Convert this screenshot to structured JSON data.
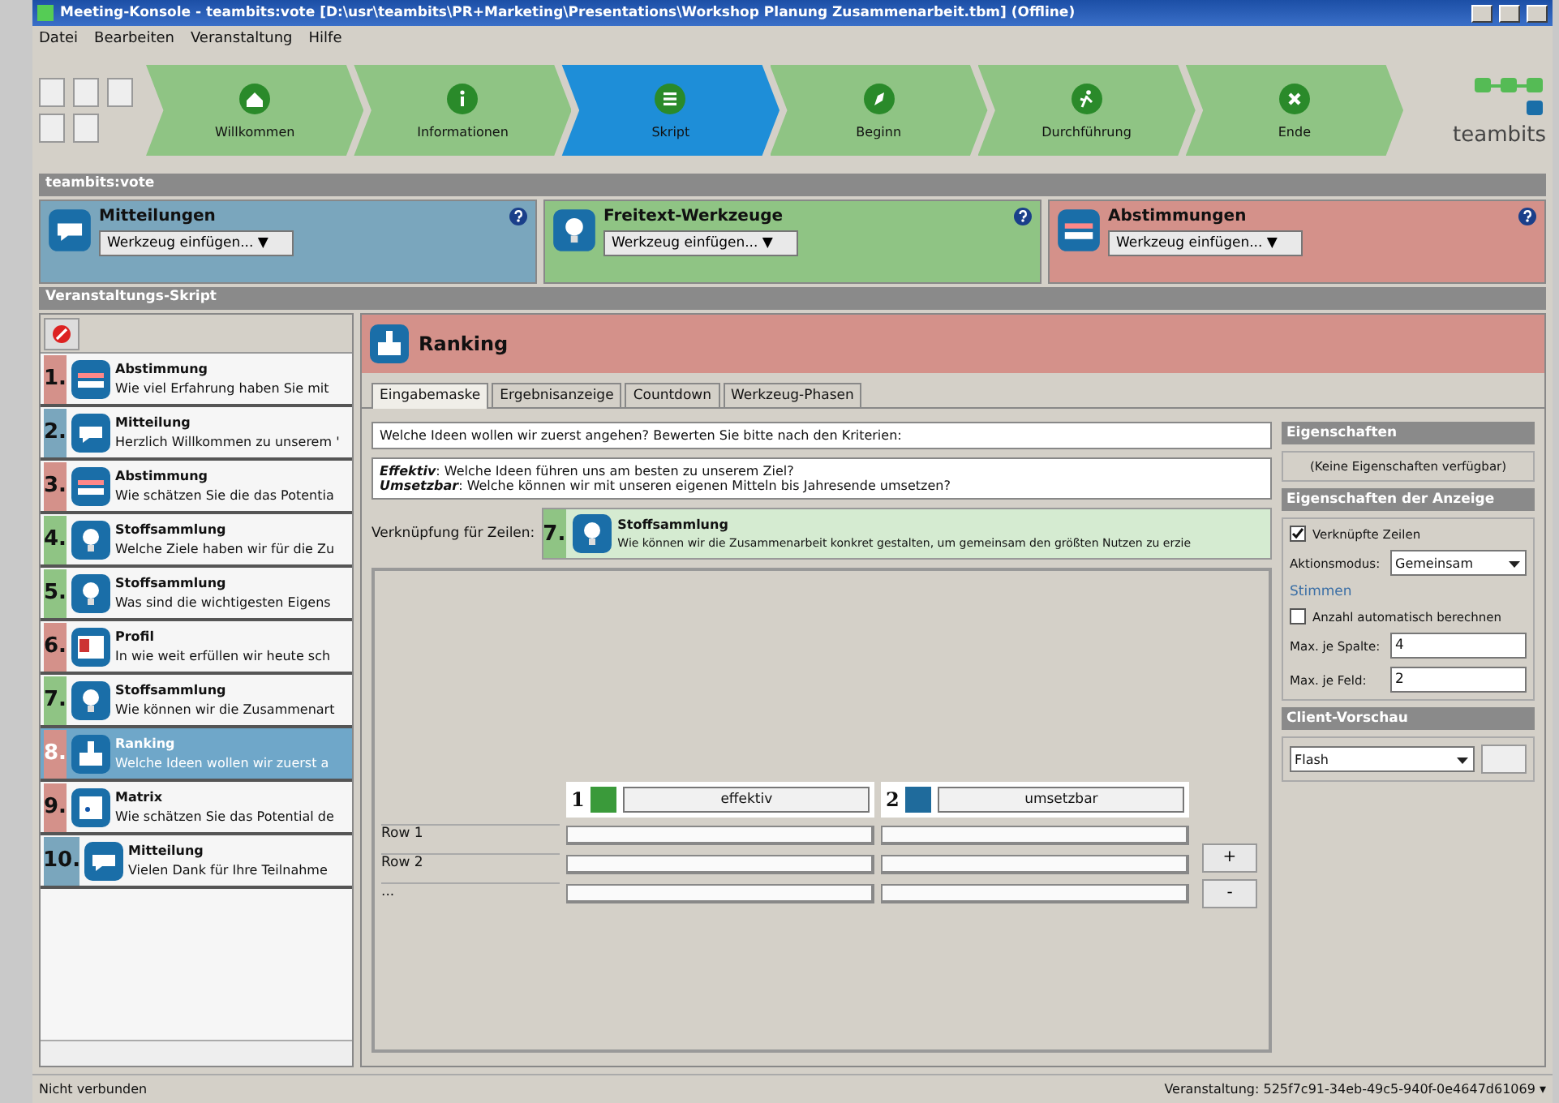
{
  "window": {
    "title": "Meeting-Konsole - teambits:vote [D:\\usr\\teambits\\PR+Marketing\\Presentations\\Workshop Planung Zusammenarbeit.tbm] (Offline)"
  },
  "menu": [
    "Datei",
    "Bearbeiten",
    "Veranstaltung",
    "Hilfe"
  ],
  "steps": [
    {
      "label": "Willkommen",
      "kind": "home",
      "selected": false
    },
    {
      "label": "Informationen",
      "kind": "info",
      "selected": false
    },
    {
      "label": "Skript",
      "kind": "list",
      "selected": true
    },
    {
      "label": "Beginn",
      "kind": "start",
      "selected": false
    },
    {
      "label": "Durchführung",
      "kind": "run",
      "selected": false
    },
    {
      "label": "Ende",
      "kind": "close",
      "selected": false
    }
  ],
  "logo": "teambits",
  "app_bar": "teambits:vote",
  "tool_groups": [
    {
      "title": "Mitteilungen",
      "kind": "message",
      "color": "#7aa6bd",
      "dropdown": "Werkzeug einfügen... ▼"
    },
    {
      "title": "Freitext-Werkzeuge",
      "kind": "idea",
      "color": "#8fc484",
      "dropdown": "Werkzeug einfügen... ▼"
    },
    {
      "title": "Abstimmungen",
      "kind": "vote",
      "color": "#d4918a",
      "dropdown": "Werkzeug einfügen... ▼"
    }
  ],
  "script_bar": "Veranstaltungs-Skript",
  "script_items": [
    {
      "number": "1.",
      "title": "Abstimmung",
      "text": "Wie viel Erfahrung haben Sie mit",
      "kind": "vote",
      "color": "#d4918a",
      "selected": false
    },
    {
      "number": "2.",
      "title": "Mitteilung",
      "text": "Herzlich Willkommen zu unserem '",
      "kind": "message",
      "color": "#7aa6bd",
      "selected": false
    },
    {
      "number": "3.",
      "title": "Abstimmung",
      "text": "Wie schätzen Sie die das Potentia",
      "kind": "vote",
      "color": "#d4918a",
      "selected": false
    },
    {
      "number": "4.",
      "title": "Stoffsammlung",
      "text": "Welche Ziele haben wir für die Zu",
      "kind": "idea",
      "color": "#8fc484",
      "selected": false
    },
    {
      "number": "5.",
      "title": "Stoffsammlung",
      "text": "Was sind die wichtigesten Eigens",
      "kind": "idea",
      "color": "#8fc484",
      "selected": false
    },
    {
      "number": "6.",
      "title": "Profil",
      "text": "In wie weit erfüllen wir heute sch",
      "kind": "profile",
      "color": "#d4918a",
      "selected": false
    },
    {
      "number": "7.",
      "title": "Stoffsammlung",
      "text": "Wie können wir die Zusammenart",
      "kind": "idea",
      "color": "#8fc484",
      "selected": false
    },
    {
      "number": "8.",
      "title": "Ranking",
      "text": "Welche Ideen wollen wir zuerst a",
      "kind": "ranking",
      "color": "#d4918a",
      "selected": true
    },
    {
      "number": "9.",
      "title": "Matrix",
      "text": "Wie schätzen Sie das Potential de",
      "kind": "matrix",
      "color": "#d4918a",
      "selected": false
    },
    {
      "number": "10.",
      "title": "Mitteilung",
      "text": "Vielen Dank für Ihre Teilnahme",
      "kind": "message",
      "color": "#7aa6bd",
      "selected": false
    }
  ],
  "editor": {
    "title": "Ranking",
    "tabs": [
      {
        "label": "Eingabemaske",
        "selected": true
      },
      {
        "label": "Ergebnisanzeige",
        "selected": false
      },
      {
        "label": "Countdown",
        "selected": false
      },
      {
        "label": "Werkzeug-Phasen",
        "selected": false
      }
    ],
    "question": "Welche Ideen wollen wir zuerst angehen? Bewerten Sie bitte nach den Kriterien:",
    "description": [
      "**Effektiv**: Welche Ideen führen uns am besten zu unserem Ziel?",
      "**Umsetzbar**: Welche können wir mit unseren eigenen Mitteln bis Jahresende umsetzen?"
    ],
    "link_label": "Verknüpfung für Zeilen:",
    "link": {
      "number": "7.",
      "title": "Stoffsammlung",
      "text": "Wie können wir die Zusammenarbeit konkret gestalten, um gemeinsam den größten Nutzen zu erzie"
    },
    "criteria": [
      {
        "number": "1",
        "color": "#3a9a3a",
        "label": "effektiv"
      },
      {
        "number": "2",
        "color": "#1f6b9c",
        "label": "umsetzbar"
      }
    ],
    "rows": [
      "Row 1",
      "Row 2",
      "..."
    ],
    "buttons": [
      "+",
      "-"
    ]
  },
  "properties": {
    "title": "Eigenschaften",
    "empty": "(Keine Eigenschaften verfügbar)",
    "display_title": "Eigenschaften der Anzeige",
    "linked_rows": {
      "label": "Verknüpfte Zeilen",
      "checked": true
    },
    "mode_label": "Aktionsmodus:",
    "mode": "Gemeinsam",
    "votes_title": "Stimmen",
    "auto_count": {
      "label": "Anzahl automatisch berechnen",
      "checked": false
    },
    "max_column_label": "Max. je Spalte:",
    "max_column": "4",
    "max_field_label": "Max. je Feld:",
    "max_field": "2",
    "preview_title": "Client-Vorschau",
    "preview": "Flash"
  },
  "status": {
    "left": "Nicht verbunden",
    "right": "Veranstaltung: 525f7c91-34eb-49c5-940f-0e4647d61069 ▾"
  }
}
